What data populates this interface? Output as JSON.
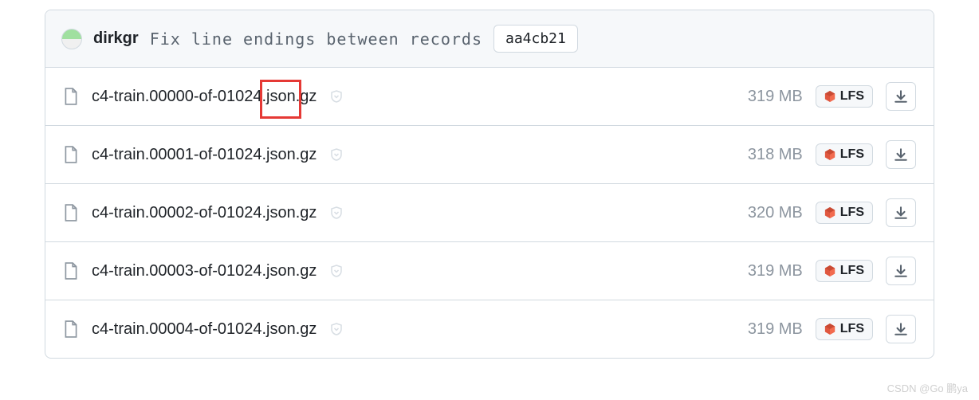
{
  "header": {
    "author": "dirkgr",
    "commit_message": "Fix line endings between records",
    "commit_hash": "aa4cb21"
  },
  "files": [
    {
      "name": "c4-train.00000-of-01024.json.gz",
      "size": "319 MB",
      "lfs": "LFS"
    },
    {
      "name": "c4-train.00001-of-01024.json.gz",
      "size": "318 MB",
      "lfs": "LFS"
    },
    {
      "name": "c4-train.00002-of-01024.json.gz",
      "size": "320 MB",
      "lfs": "LFS"
    },
    {
      "name": "c4-train.00003-of-01024.json.gz",
      "size": "319 MB",
      "lfs": "LFS"
    },
    {
      "name": "c4-train.00004-of-01024.json.gz",
      "size": "319 MB",
      "lfs": "LFS"
    }
  ],
  "highlight": {
    "text": ".json."
  },
  "watermark": "CSDN @Go 鹏ya"
}
